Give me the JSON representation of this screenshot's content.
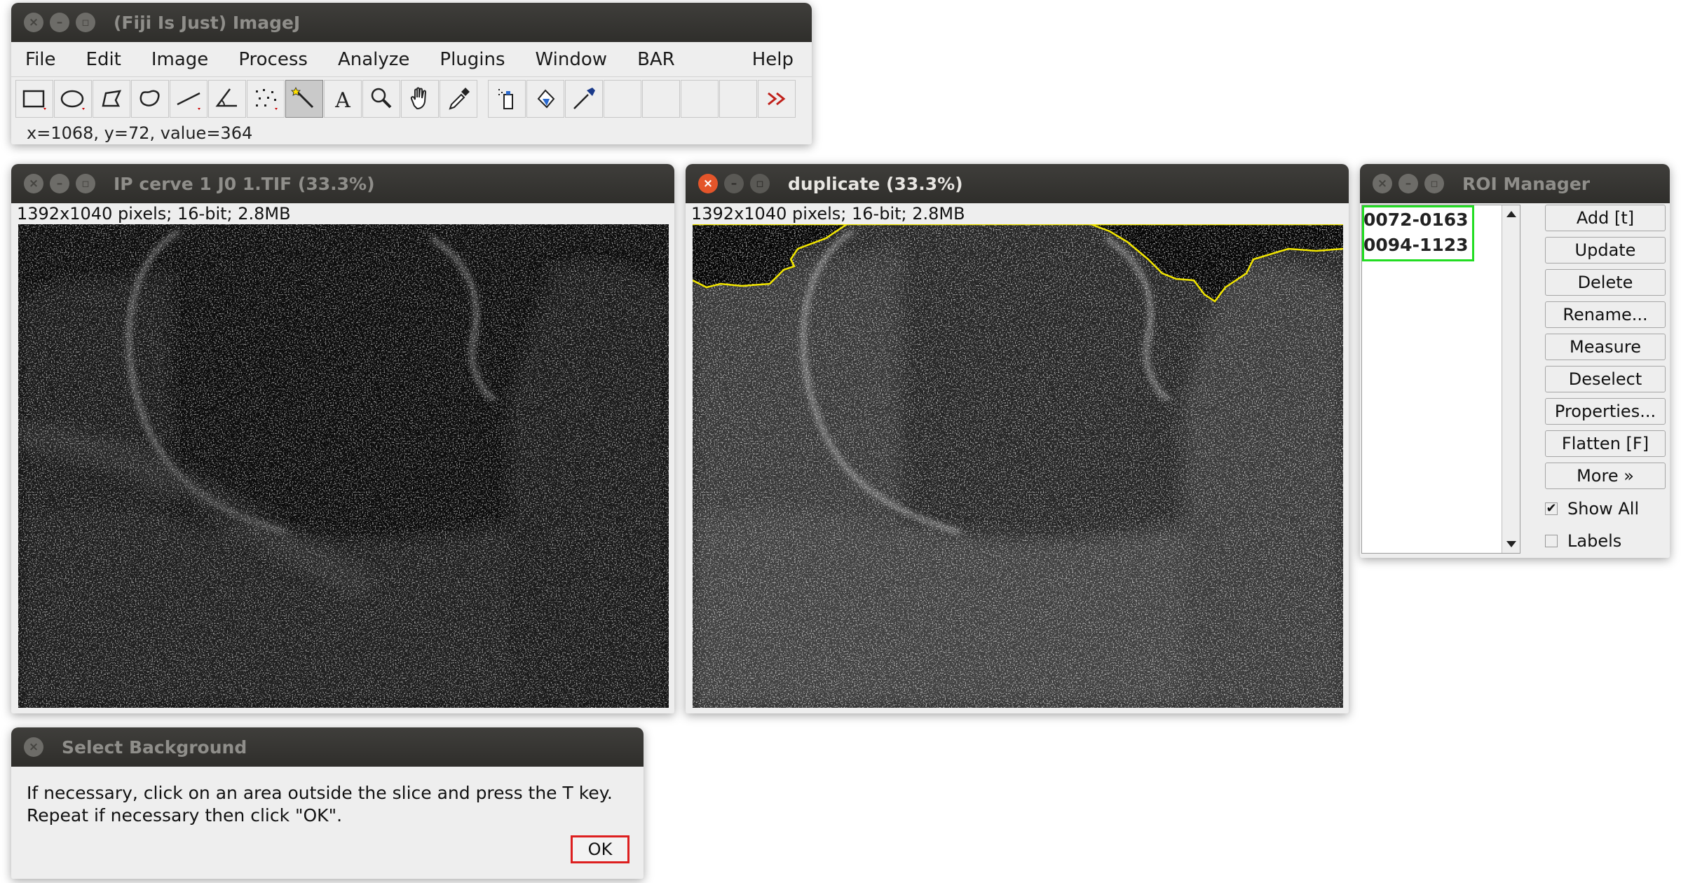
{
  "imagej": {
    "title": "(Fiji Is Just) ImageJ",
    "menus": [
      "File",
      "Edit",
      "Image",
      "Process",
      "Analyze",
      "Plugins",
      "Window",
      "BAR"
    ],
    "help_menu": "Help",
    "tools": [
      "rectangle-tool-icon",
      "oval-tool-icon",
      "polygon-tool-icon",
      "freehand-tool-icon",
      "line-tool-icon",
      "angle-tool-icon",
      "point-tool-icon",
      "wand-tool-icon",
      "text-tool-icon",
      "zoom-tool-icon",
      "hand-tool-icon",
      "color-picker-icon",
      "spray-tool-icon",
      "flood-fill-icon",
      "pipette-icon",
      "empty-slot-icon",
      "empty-slot-icon",
      "empty-slot-icon",
      "empty-slot-icon",
      "more-tools-icon"
    ],
    "status": "x=1068, y=72, value=364"
  },
  "window1": {
    "title": "IP cerve 1 J0 1.TIF (33.3%)",
    "info": "1392x1040 pixels; 16-bit; 2.8MB"
  },
  "window2": {
    "title": "duplicate (33.3%)",
    "info": "1392x1040 pixels; 16-bit; 2.8MB"
  },
  "roi_manager": {
    "title": "ROI Manager",
    "items": [
      "0072-0163",
      "0094-1123"
    ],
    "buttons": [
      "Add [t]",
      "Update",
      "Delete",
      "Rename...",
      "Measure",
      "Deselect",
      "Properties...",
      "Flatten [F]",
      "More »"
    ],
    "show_all": "Show All",
    "labels": "Labels",
    "show_all_checked": true,
    "labels_checked": false
  },
  "dialog": {
    "title": "Select Background",
    "line1": "If necessary, click on an area outside the slice and press the T key.",
    "line2": "Repeat if necessary then click \"OK\".",
    "ok": "OK"
  },
  "colors": {
    "roi_outline": "#f2e600",
    "roi_highlight": "#22dd22",
    "ok_highlight": "#dd1f1f",
    "titlebar": "#3a3936"
  }
}
